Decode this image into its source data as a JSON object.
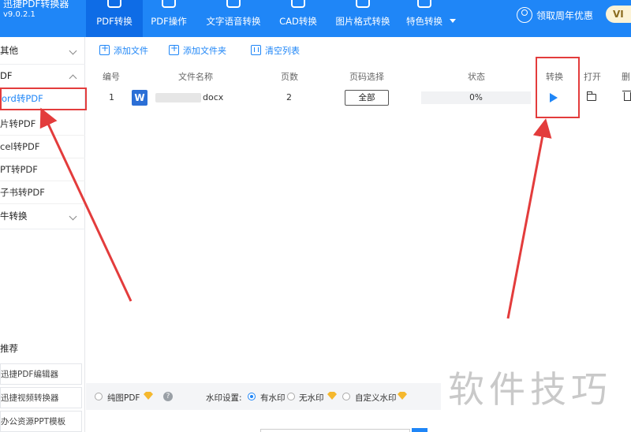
{
  "app": {
    "title": "迅捷PDF转换器",
    "version": "v9.0.2.1"
  },
  "nav": {
    "tabs": [
      {
        "label": "PDF转换",
        "icon": "pdf-convert-icon",
        "active": true
      },
      {
        "label": "PDF操作",
        "icon": "pdf-operate-icon",
        "active": false
      },
      {
        "label": "文字语音转换",
        "icon": "text-speech-icon",
        "active": false
      },
      {
        "label": "CAD转换",
        "icon": "cad-icon",
        "active": false
      },
      {
        "label": "图片格式转换",
        "icon": "image-format-icon",
        "active": false
      },
      {
        "label": "特色转换",
        "icon": "special-convert-icon",
        "active": false
      }
    ],
    "promo": "领取周年优惠",
    "vip": "VI"
  },
  "sidebar": {
    "groups": [
      {
        "label": "其他",
        "expanded": false
      },
      {
        "label": "DF",
        "expanded": true
      },
      {
        "label": "牛转换",
        "expanded": false
      }
    ],
    "items": [
      {
        "label": "ord转PDF",
        "active": true
      },
      {
        "label": "片转PDF",
        "active": false
      },
      {
        "label": "cel转PDF",
        "active": false
      },
      {
        "label": "PT转PDF",
        "active": false
      },
      {
        "label": "子书转PDF",
        "active": false
      }
    ],
    "recommend_title": "推荐",
    "recommend": [
      {
        "label": "迅捷PDF编辑器"
      },
      {
        "label": "迅捷视频转换器"
      },
      {
        "label": "办公资源PPT模板"
      }
    ]
  },
  "toolbar": {
    "add_file": "添加文件",
    "add_folder": "添加文件夹",
    "clear_list": "清空列表"
  },
  "table": {
    "headers": [
      "编号",
      "文件名称",
      "页数",
      "页码选择",
      "状态",
      "转换",
      "打开",
      "删"
    ],
    "rows": [
      {
        "index": "1",
        "file_icon": "W",
        "filename_suffix": "docx",
        "pages": "2",
        "page_select": "全部",
        "progress": 0,
        "progress_text": "0%"
      }
    ]
  },
  "bottom": {
    "pure_pdf": "纯图PDF",
    "watermark_label": "水印设置:",
    "opt_with": "有水印",
    "opt_without": "无水印",
    "opt_custom": "自定义水印",
    "watermark_selected": "有水印"
  },
  "watermark_text": "软件技巧",
  "colors": {
    "brand": "#1f86f7",
    "annotation": "#e33c3c"
  }
}
